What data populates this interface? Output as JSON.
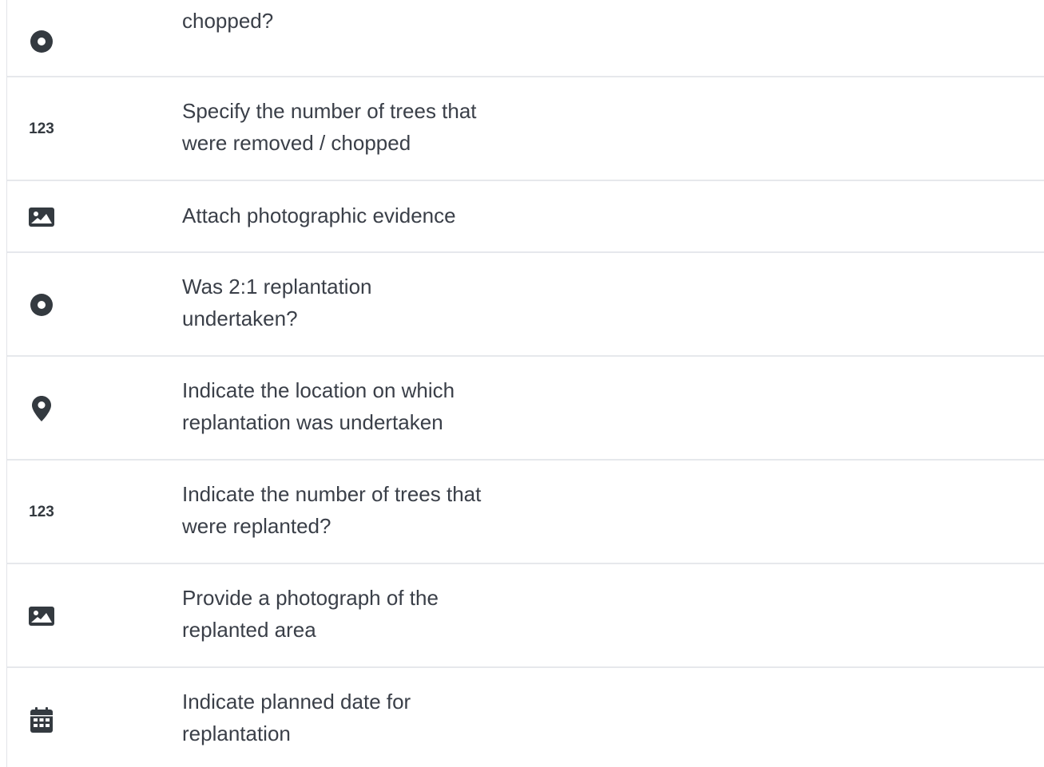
{
  "rows": [
    {
      "icon": "radio-icon",
      "label": "chopped?"
    },
    {
      "icon": "number-icon",
      "icon_text": "123",
      "label": "Specify the number of trees that\nwere removed / chopped"
    },
    {
      "icon": "image-icon",
      "label": "Attach photographic evidence"
    },
    {
      "icon": "radio-icon",
      "label": "Was 2:1 replantation\nundertaken?"
    },
    {
      "icon": "location-pin-icon",
      "label": "Indicate the location on which\nreplantation was undertaken"
    },
    {
      "icon": "number-icon",
      "icon_text": "123",
      "label": "Indicate the number of trees that\nwere replanted?"
    },
    {
      "icon": "image-icon",
      "label": "Provide a photograph of the\nreplanted area"
    },
    {
      "icon": "calendar-icon",
      "label": "Indicate planned date for\nreplantation"
    }
  ],
  "colors": {
    "text": "#3a3f48",
    "icon": "#343a40",
    "divider": "#e6e8ec"
  }
}
